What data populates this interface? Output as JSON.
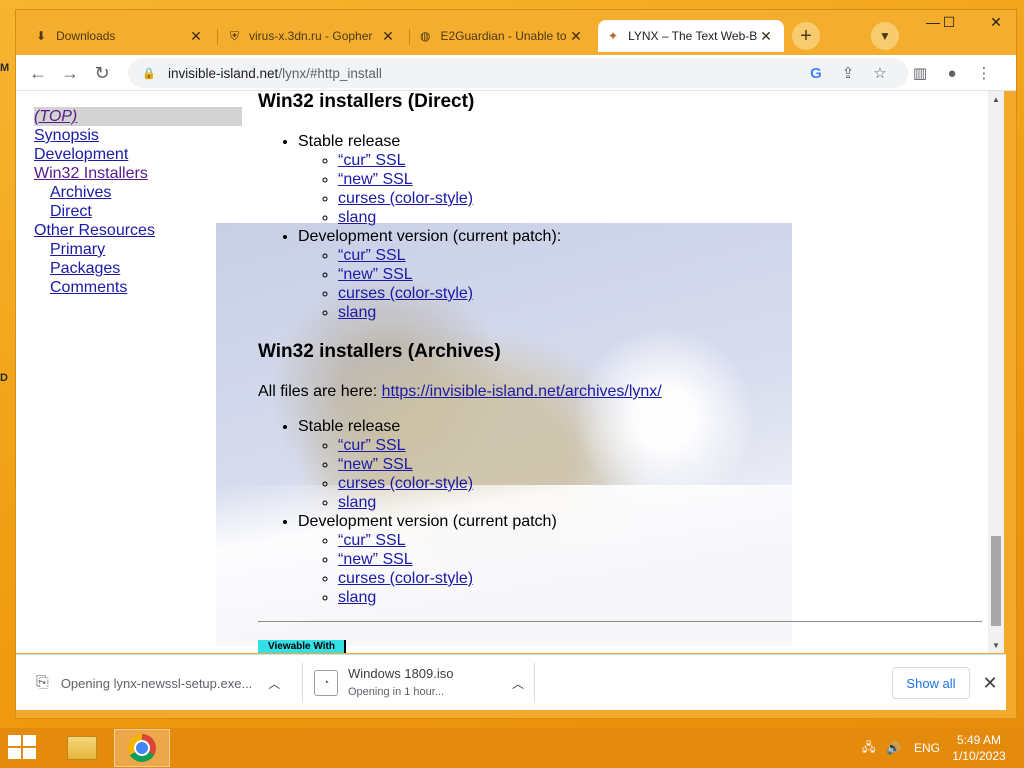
{
  "browser": {
    "tabs": [
      {
        "title": "Downloads",
        "icon": "download-icon",
        "active": false
      },
      {
        "title": "virus-x.3dn.ru - Gopher",
        "icon": "shield-icon",
        "active": false
      },
      {
        "title": "E2Guardian - Unable to",
        "icon": "globe-icon",
        "active": false
      },
      {
        "title": "LYNX – The Text Web-B",
        "icon": "lynx-cat-icon",
        "active": true
      }
    ],
    "address": {
      "host": "invisible-island.net",
      "path": "/lynx/#http_install"
    }
  },
  "page": {
    "nav": {
      "top": "(TOP)",
      "synopsis": "Synopsis",
      "development": "Development",
      "win32": "Win32 Installers",
      "archives": "Archives",
      "direct": "Direct",
      "other": "Other Resources",
      "primary": "Primary",
      "packages": "Packages",
      "comments": "Comments"
    },
    "direct": {
      "heading": "Win32 installers (Direct)",
      "stable": "Stable release",
      "dev": "Development version (current patch):",
      "links": [
        "“cur” SSL",
        "“new” SSL",
        "curses (color-style)",
        "slang"
      ]
    },
    "archives": {
      "heading": "Win32 installers (Archives)",
      "intro": "All files are here: ",
      "url": "https://invisible-island.net/archives/lynx/",
      "stable": "Stable release",
      "dev": "Development version (current patch)",
      "links": [
        "“cur” SSL",
        "“new” SSL",
        "curses (color-style)",
        "slang"
      ]
    },
    "badge": "Viewable With"
  },
  "downloads": {
    "items": [
      {
        "text": "Opening lynx-newssl-setup.exe...",
        "sub": ""
      },
      {
        "text": "Windows 1809.iso",
        "sub": "Opening in 1 hour..."
      }
    ],
    "show_all": "Show all"
  },
  "taskbar": {
    "lang": "ENG",
    "time": "5:49 AM",
    "date": "1/10/2023"
  },
  "desktop": {
    "glyph1": "M",
    "glyph2": "D"
  },
  "colors": {
    "accent": "#f5ad2e",
    "link": "#1a1aa6",
    "visited": "#551a8b"
  }
}
